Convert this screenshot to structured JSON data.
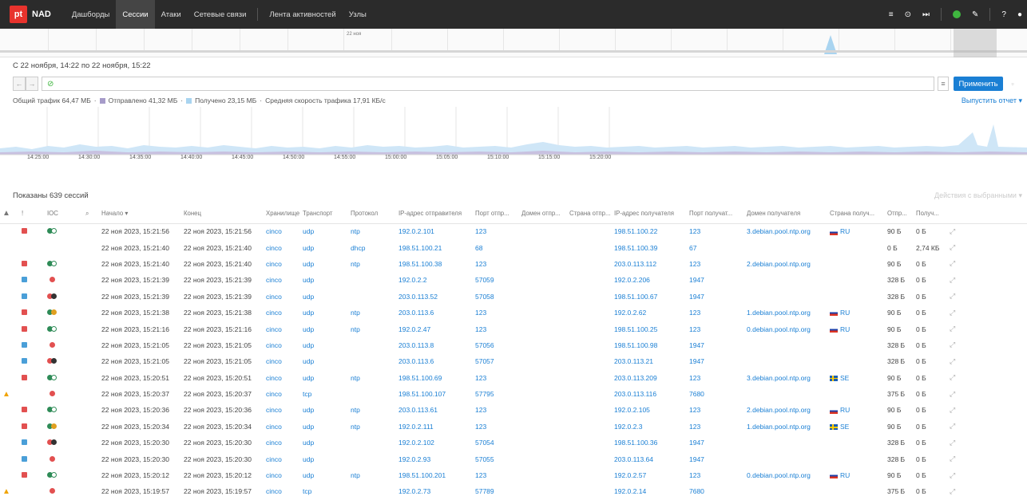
{
  "app": {
    "logo": "pt",
    "name": "NAD"
  },
  "nav": [
    {
      "label": "Дашборды",
      "active": false
    },
    {
      "label": "Сессии",
      "active": true
    },
    {
      "label": "Атаки",
      "active": false
    },
    {
      "label": "Сетевые связи",
      "active": false
    },
    {
      "label": "Лента активностей",
      "active": false
    },
    {
      "label": "Узлы",
      "active": false
    }
  ],
  "timeline": {
    "label": "22 ноя"
  },
  "range_text": "С 22 ноября, 14:22 по 22 ноября, 15:22",
  "filter": {
    "apply_label": "Применить"
  },
  "stats": {
    "total": "Общий трафик 64,47 МБ",
    "sent": "Отправлено 41,32 МБ",
    "received": "Получено 23,15 МБ",
    "speed": "Средняя скорость трафика 17,91 КБ/с",
    "sent_color": "#a69bc9",
    "received_color": "#a9d4f0"
  },
  "report_label": "Выпустить отчет",
  "axis_ticks": [
    "14:25:00",
    "14:30:00",
    "14:35:00",
    "14:40:00",
    "14:45:00",
    "14:50:00",
    "14:55:00",
    "15:00:00",
    "15:05:00",
    "15:10:00",
    "15:15:00",
    "15:20:00"
  ],
  "shown_label": "Показаны 639 сессий",
  "actions_label": "Действия с выбранными",
  "columns": [
    "!",
    "IOC",
    "",
    "Начало",
    "Конец",
    "Хранилище",
    "Транспорт",
    "Протокол",
    "IP-адрес отправителя",
    "Порт отпр...",
    "Домен отпр...",
    "Страна отпр...",
    "IP-адрес получателя",
    "Порт получат...",
    "Домен получателя",
    "Страна получ...",
    "Отпр...",
    "Получ..."
  ],
  "rows": [
    {
      "warn": "",
      "sev": "r",
      "ioc": "gw",
      "start": "22 ноя 2023, 15:21:56",
      "end": "22 ноя 2023, 15:21:56",
      "store": "cinco",
      "transport": "udp",
      "proto": "ntp",
      "src": "192.0.2.101",
      "sport": "123",
      "dst": "198.51.100.22",
      "dport": "123",
      "ddomain": "3.debian.pool.ntp.org",
      "flag": "ru",
      "country": "RU",
      "sent": "90 Б",
      "recv": "0 Б"
    },
    {
      "warn": "",
      "sev": "",
      "ioc": "",
      "start": "22 ноя 2023, 15:21:40",
      "end": "22 ноя 2023, 15:21:40",
      "store": "cinco",
      "transport": "udp",
      "proto": "dhcp",
      "src": "198.51.100.21",
      "sport": "68",
      "dst": "198.51.100.39",
      "dport": "67",
      "ddomain": "",
      "flag": "",
      "country": "",
      "sent": "0 Б",
      "recv": "2,74 КБ"
    },
    {
      "warn": "",
      "sev": "r",
      "ioc": "gw",
      "start": "22 ноя 2023, 15:21:40",
      "end": "22 ноя 2023, 15:21:40",
      "store": "cinco",
      "transport": "udp",
      "proto": "ntp",
      "src": "198.51.100.38",
      "sport": "123",
      "dst": "203.0.113.112",
      "dport": "123",
      "ddomain": "2.debian.pool.ntp.org",
      "flag": "",
      "country": "",
      "sent": "90 Б",
      "recv": "0 Б"
    },
    {
      "warn": "",
      "sev": "b",
      "ioc": "r",
      "start": "22 ноя 2023, 15:21:39",
      "end": "22 ноя 2023, 15:21:39",
      "store": "cinco",
      "transport": "udp",
      "proto": "",
      "src": "192.0.2.2",
      "sport": "57059",
      "dst": "192.0.2.206",
      "dport": "1947",
      "ddomain": "",
      "flag": "",
      "country": "",
      "sent": "328 Б",
      "recv": "0 Б"
    },
    {
      "warn": "",
      "sev": "b",
      "ioc": "rk",
      "start": "22 ноя 2023, 15:21:39",
      "end": "22 ноя 2023, 15:21:39",
      "store": "cinco",
      "transport": "udp",
      "proto": "",
      "src": "203.0.113.52",
      "sport": "57058",
      "dst": "198.51.100.67",
      "dport": "1947",
      "ddomain": "",
      "flag": "",
      "country": "",
      "sent": "328 Б",
      "recv": "0 Б"
    },
    {
      "warn": "",
      "sev": "r",
      "ioc": "go",
      "start": "22 ноя 2023, 15:21:38",
      "end": "22 ноя 2023, 15:21:38",
      "store": "cinco",
      "transport": "udp",
      "proto": "ntp",
      "src": "203.0.113.6",
      "sport": "123",
      "dst": "192.0.2.62",
      "dport": "123",
      "ddomain": "1.debian.pool.ntp.org",
      "flag": "ru",
      "country": "RU",
      "sent": "90 Б",
      "recv": "0 Б"
    },
    {
      "warn": "",
      "sev": "r",
      "ioc": "gw",
      "start": "22 ноя 2023, 15:21:16",
      "end": "22 ноя 2023, 15:21:16",
      "store": "cinco",
      "transport": "udp",
      "proto": "ntp",
      "src": "192.0.2.47",
      "sport": "123",
      "dst": "198.51.100.25",
      "dport": "123",
      "ddomain": "0.debian.pool.ntp.org",
      "flag": "ru",
      "country": "RU",
      "sent": "90 Б",
      "recv": "0 Б"
    },
    {
      "warn": "",
      "sev": "b",
      "ioc": "r",
      "start": "22 ноя 2023, 15:21:05",
      "end": "22 ноя 2023, 15:21:05",
      "store": "cinco",
      "transport": "udp",
      "proto": "",
      "src": "203.0.113.8",
      "sport": "57056",
      "dst": "198.51.100.98",
      "dport": "1947",
      "ddomain": "",
      "flag": "",
      "country": "",
      "sent": "328 Б",
      "recv": "0 Б"
    },
    {
      "warn": "",
      "sev": "b",
      "ioc": "rk",
      "start": "22 ноя 2023, 15:21:05",
      "end": "22 ноя 2023, 15:21:05",
      "store": "cinco",
      "transport": "udp",
      "proto": "",
      "src": "203.0.113.6",
      "sport": "57057",
      "dst": "203.0.113.21",
      "dport": "1947",
      "ddomain": "",
      "flag": "",
      "country": "",
      "sent": "328 Б",
      "recv": "0 Б"
    },
    {
      "warn": "",
      "sev": "r",
      "ioc": "gw",
      "start": "22 ноя 2023, 15:20:51",
      "end": "22 ноя 2023, 15:20:51",
      "store": "cinco",
      "transport": "udp",
      "proto": "ntp",
      "src": "198.51.100.69",
      "sport": "123",
      "dst": "203.0.113.209",
      "dport": "123",
      "ddomain": "3.debian.pool.ntp.org",
      "flag": "se",
      "country": "SE",
      "sent": "90 Б",
      "recv": "0 Б"
    },
    {
      "warn": "▲",
      "sev": "",
      "ioc": "r",
      "start": "22 ноя 2023, 15:20:37",
      "end": "22 ноя 2023, 15:20:37",
      "store": "cinco",
      "transport": "tcp",
      "proto": "",
      "src": "198.51.100.107",
      "sport": "57795",
      "dst": "203.0.113.116",
      "dport": "7680",
      "ddomain": "",
      "flag": "",
      "country": "",
      "sent": "375 Б",
      "recv": "0 Б"
    },
    {
      "warn": "",
      "sev": "r",
      "ioc": "gw",
      "start": "22 ноя 2023, 15:20:36",
      "end": "22 ноя 2023, 15:20:36",
      "store": "cinco",
      "transport": "udp",
      "proto": "ntp",
      "src": "203.0.113.61",
      "sport": "123",
      "dst": "192.0.2.105",
      "dport": "123",
      "ddomain": "2.debian.pool.ntp.org",
      "flag": "ru",
      "country": "RU",
      "sent": "90 Б",
      "recv": "0 Б"
    },
    {
      "warn": "",
      "sev": "r",
      "ioc": "go",
      "start": "22 ноя 2023, 15:20:34",
      "end": "22 ноя 2023, 15:20:34",
      "store": "cinco",
      "transport": "udp",
      "proto": "ntp",
      "src": "192.0.2.111",
      "sport": "123",
      "dst": "192.0.2.3",
      "dport": "123",
      "ddomain": "1.debian.pool.ntp.org",
      "flag": "se",
      "country": "SE",
      "sent": "90 Б",
      "recv": "0 Б"
    },
    {
      "warn": "",
      "sev": "b",
      "ioc": "rk",
      "start": "22 ноя 2023, 15:20:30",
      "end": "22 ноя 2023, 15:20:30",
      "store": "cinco",
      "transport": "udp",
      "proto": "",
      "src": "192.0.2.102",
      "sport": "57054",
      "dst": "198.51.100.36",
      "dport": "1947",
      "ddomain": "",
      "flag": "",
      "country": "",
      "sent": "328 Б",
      "recv": "0 Б"
    },
    {
      "warn": "",
      "sev": "b",
      "ioc": "r",
      "start": "22 ноя 2023, 15:20:30",
      "end": "22 ноя 2023, 15:20:30",
      "store": "cinco",
      "transport": "udp",
      "proto": "",
      "src": "192.0.2.93",
      "sport": "57055",
      "dst": "203.0.113.64",
      "dport": "1947",
      "ddomain": "",
      "flag": "",
      "country": "",
      "sent": "328 Б",
      "recv": "0 Б"
    },
    {
      "warn": "",
      "sev": "r",
      "ioc": "gw",
      "start": "22 ноя 2023, 15:20:12",
      "end": "22 ноя 2023, 15:20:12",
      "store": "cinco",
      "transport": "udp",
      "proto": "ntp",
      "src": "198.51.100.201",
      "sport": "123",
      "dst": "192.0.2.57",
      "dport": "123",
      "ddomain": "0.debian.pool.ntp.org",
      "flag": "ru",
      "country": "RU",
      "sent": "90 Б",
      "recv": "0 Б"
    },
    {
      "warn": "▲",
      "sev": "",
      "ioc": "r",
      "start": "22 ноя 2023, 15:19:57",
      "end": "22 ноя 2023, 15:19:57",
      "store": "cinco",
      "transport": "tcp",
      "proto": "",
      "src": "192.0.2.73",
      "sport": "57789",
      "dst": "192.0.2.14",
      "dport": "7680",
      "ddomain": "",
      "flag": "",
      "country": "",
      "sent": "375 Б",
      "recv": "0 Б"
    }
  ]
}
